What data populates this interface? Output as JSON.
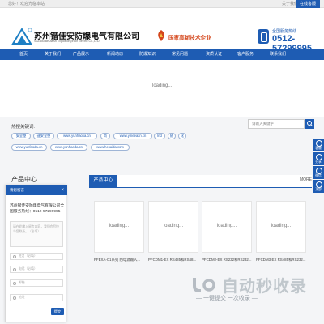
{
  "topbar": {
    "welcome": "您好！欢迎光临本站",
    "about": "关于我们",
    "contact": "在线客服"
  },
  "header": {
    "company": "苏州锴佳安防爆电气有限公司",
    "company_en": "SuZhou BeiJiaAn Explosion-proof Electric Co.,LTD",
    "hitech": "国家高新技术企业",
    "hotline_label": "全国服务热线",
    "hotline_number": "0512-57299995"
  },
  "nav": [
    "首页",
    "关于我们",
    "产品展示",
    "新闻动态",
    "防爆知识",
    "常见问题",
    "资质认证",
    "客户服务",
    "联系我们"
  ],
  "banner": {
    "loading": "loading..."
  },
  "hot": {
    "label": "热搜关键词:",
    "search_placeholder": "请输入关键字",
    "tags_row1": [
      "安全塑",
      "速安全塑",
      "www.yunhaoxa.cn",
      "尚",
      "www.ymeeaxn.cn",
      "lnd",
      "随",
      "化"
    ],
    "tags_row2": [
      "www.yunfaoda.cn",
      "www.yunhaoda.cn",
      "www.hesaida.com"
    ]
  },
  "side": [
    "客服",
    "分享",
    "微信",
    "顶部"
  ],
  "products": {
    "section": "产品中心",
    "tab": "产品中心",
    "more": "MORE",
    "loading": "loading...",
    "captions": [
      "PFEXA-C1系列 防电源输入...",
      "PFCDM1-EX RS485和RS48...",
      "PFCDM2-EX RS232和RS232...",
      "PFCDM3-EX RS485和RS232..."
    ]
  },
  "chat": {
    "title": "请您留言",
    "close": "×",
    "message": "苏州锴佳安防爆电气有限公司全国服务热线：0512-57299995",
    "textarea_placeholder": "请在此输入留言内容，我们会尽快与您联系。（必填）",
    "name_placeholder": "姓名（必填）",
    "phone_placeholder": "电话（必填）",
    "email_placeholder": "邮箱",
    "address_placeholder": "地址",
    "submit": "提交"
  },
  "watermark": {
    "title": "自动秒收录",
    "subtitle": "— 一键提交 一次收录 —"
  },
  "colors": {
    "brand": "#1e5cb3",
    "accent": "#d4461b"
  }
}
